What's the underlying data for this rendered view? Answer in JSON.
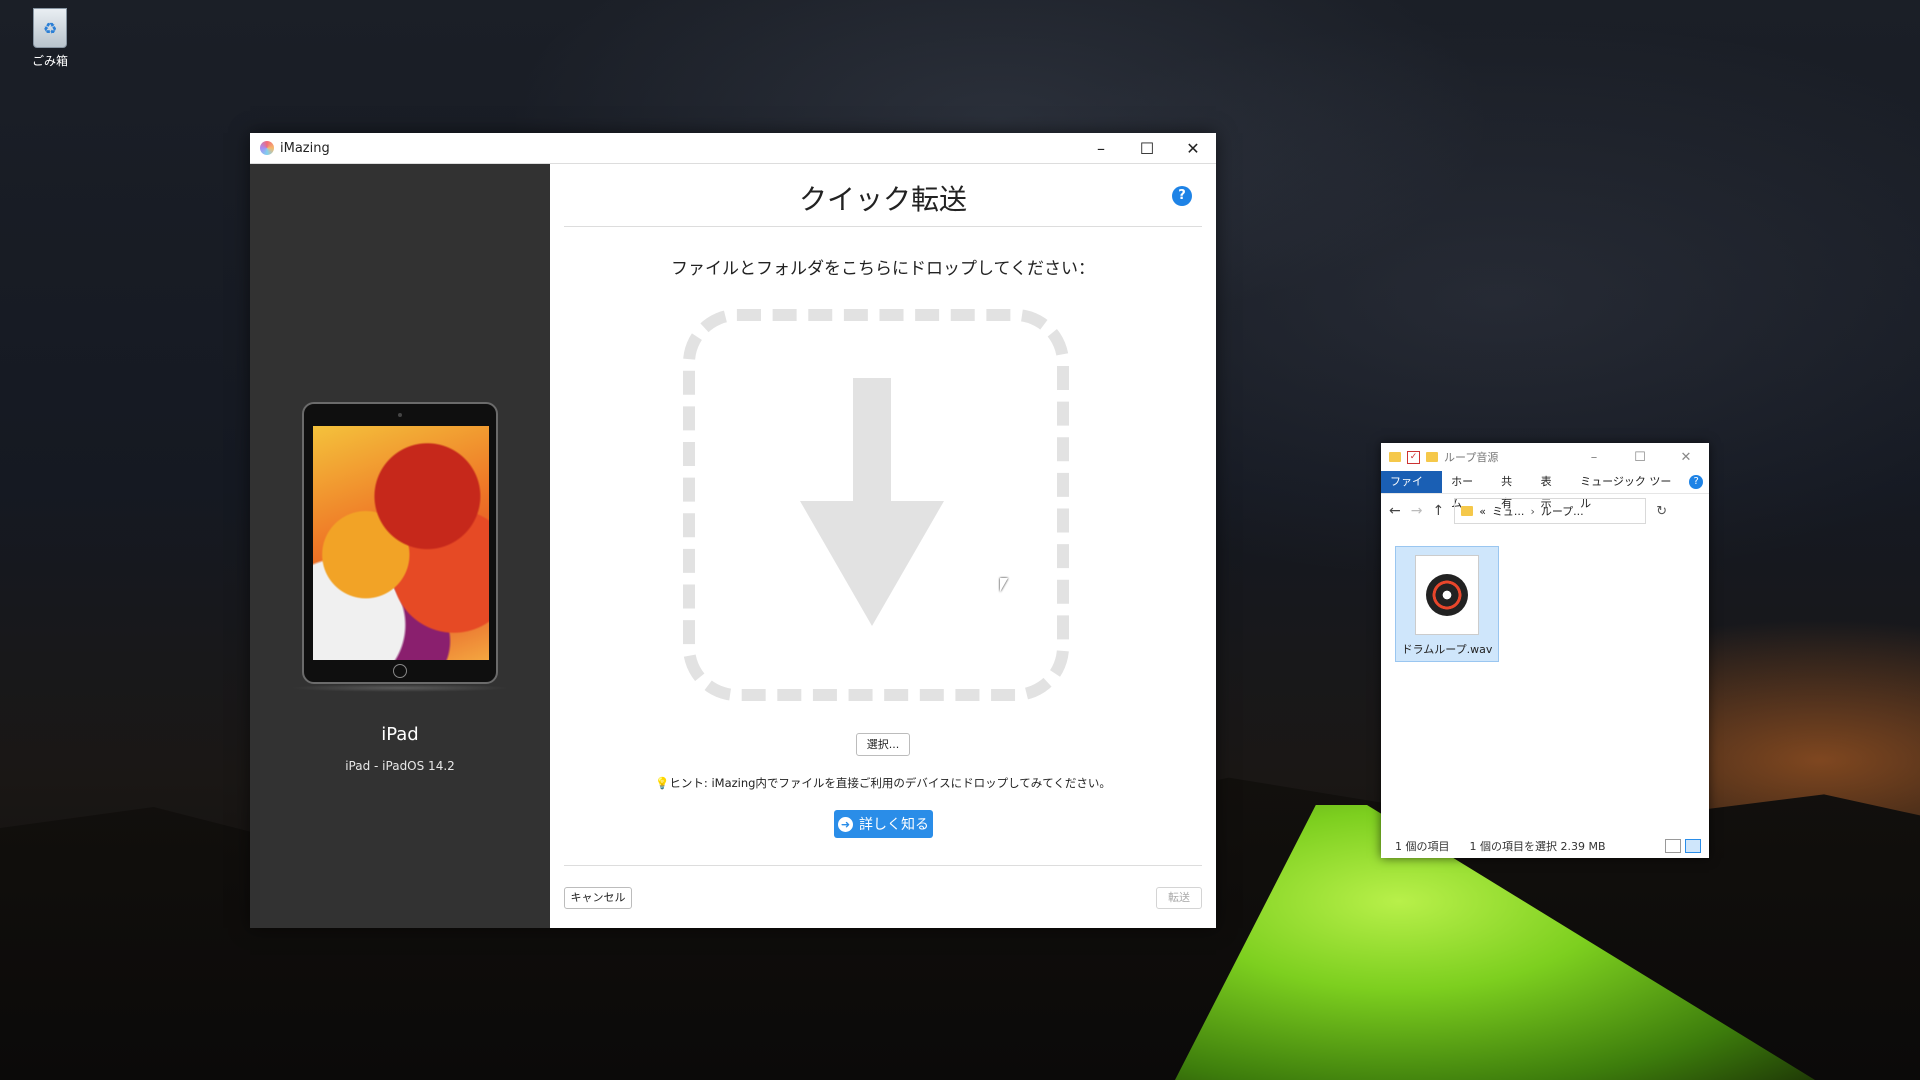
{
  "desktop": {
    "recycle_bin_label": "ごみ箱"
  },
  "imazing": {
    "window_title": "iMazing",
    "controls": {
      "minimize": "–",
      "maximize": "☐",
      "close": "✕"
    },
    "device": {
      "name": "iPad",
      "details": "iPad - iPadOS 14.2"
    },
    "title": "クイック転送",
    "help_symbol": "?",
    "drop_label": "ファイルとフォルダをこちらにドロップしてください：",
    "select_button": "選択...",
    "hint": "ヒント: iMazing内でファイルを直接ご利用のデバイスにドロップしてみてください。",
    "learn_more_button": "詳しく知る",
    "cancel_button": "キャンセル",
    "transfer_button": "転送"
  },
  "explorer": {
    "title": "ループ音源",
    "controls": {
      "minimize": "–",
      "maximize": "☐",
      "close": "✕"
    },
    "ribbon_tabs": [
      "ファイル",
      "ホーム",
      "共有",
      "表示",
      "ミュージック ツール"
    ],
    "address": {
      "prefix": "«",
      "part1": "ミュ...",
      "sep": "›",
      "part2": "ループ..."
    },
    "file": {
      "name": "ドラムループ.wav"
    },
    "status": {
      "item_count": "1 個の項目",
      "selection": "1 個の項目を選択  2.39 MB"
    }
  }
}
